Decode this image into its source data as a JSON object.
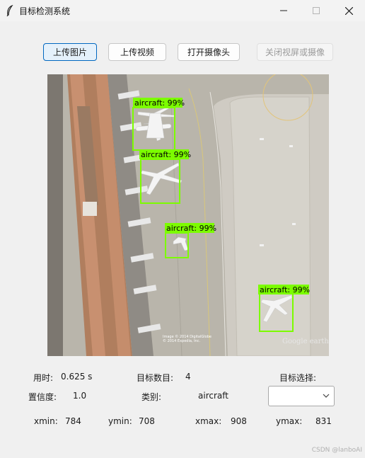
{
  "window": {
    "title": "目标检测系统"
  },
  "toolbar": {
    "upload_image": "上传图片",
    "upload_video": "上传视频",
    "open_camera": "打开摄像头",
    "close_display": "关闭视屏或摄像"
  },
  "detections": [
    {
      "label": "aircraft: 99%"
    },
    {
      "label": "aircraft: 99%"
    },
    {
      "label": "aircraft: 99%"
    },
    {
      "label": "aircraft: 99%"
    }
  ],
  "image_credits": {
    "line1": "Image © 2014 DigitalGlobe",
    "line2": "© 2014 Expedia, Inc.",
    "brand": "Google earth"
  },
  "stats": {
    "time_label": "用时:",
    "time_value": "0.625 s",
    "count_label": "目标数目:",
    "count_value": "4",
    "select_label": "目标选择:",
    "confidence_label": "置信度:",
    "confidence_value": "1.0",
    "class_label": "类别:",
    "class_value": "aircraft",
    "target_select_value": ""
  },
  "coords": {
    "xmin_label": "xmin:",
    "xmin_value": "784",
    "ymin_label": "ymin:",
    "ymin_value": "708",
    "xmax_label": "xmax:",
    "xmax_value": "908",
    "ymax_label": "ymax:",
    "ymax_value": "831"
  },
  "watermark": "CSDN @lanboAI",
  "colors": {
    "detection_box": "#7cfc00",
    "accent": "#0067c0"
  }
}
